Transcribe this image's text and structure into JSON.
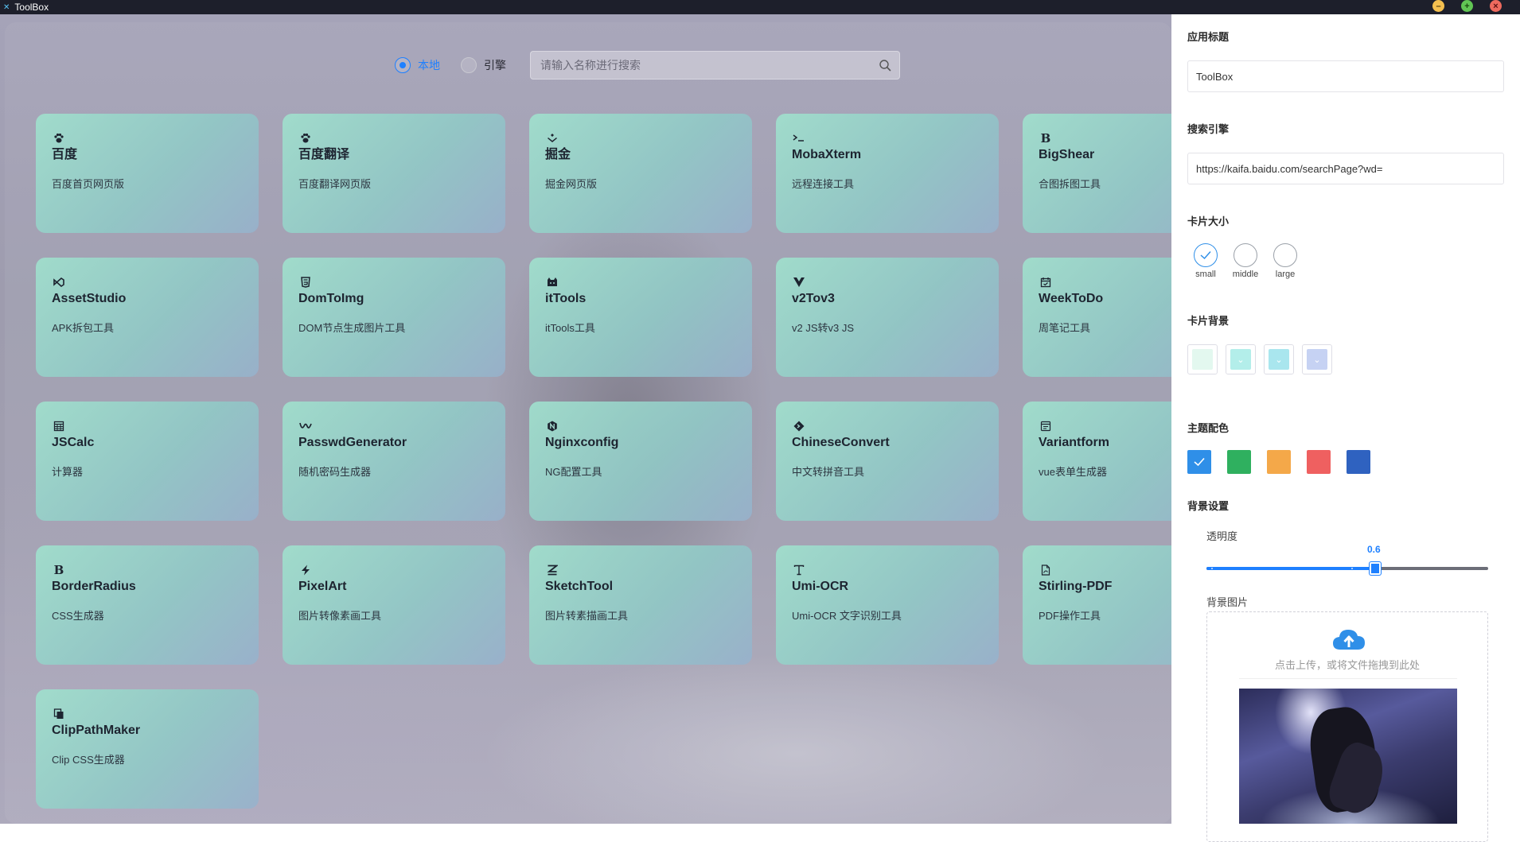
{
  "window": {
    "title": "ToolBox",
    "controls": [
      "–",
      "+",
      "×"
    ]
  },
  "search": {
    "mode_local": "本地",
    "mode_engine": "引擎",
    "selected_mode": "本地",
    "placeholder": "请输入名称进行搜索"
  },
  "cards": [
    {
      "icon": "paw-icon",
      "name": "百度",
      "desc": "百度首页网页版"
    },
    {
      "icon": "paw-icon",
      "name": "百度翻译",
      "desc": "百度翻译网页版"
    },
    {
      "icon": "juejin-icon",
      "name": "掘金",
      "desc": "掘金网页版"
    },
    {
      "icon": "terminal-icon",
      "name": "MobaXterm",
      "desc": "远程连接工具"
    },
    {
      "icon": "letter-b-icon",
      "name": "BigShear",
      "desc": "合图拆图工具"
    },
    {
      "icon": "vscode-icon",
      "name": "AssetStudio",
      "desc": "APK拆包工具"
    },
    {
      "icon": "html5-icon",
      "name": "DomToImg",
      "desc": "DOM节点生成图片工具"
    },
    {
      "icon": "cat-icon",
      "name": "itTools",
      "desc": "itTools工具"
    },
    {
      "icon": "vue-icon",
      "name": "v2Tov3",
      "desc": "v2 JS转v3 JS"
    },
    {
      "icon": "calendar-icon",
      "name": "WeekToDo",
      "desc": "周笔记工具"
    },
    {
      "icon": "calculator-icon",
      "name": "JSCalc",
      "desc": "计算器"
    },
    {
      "icon": "key-icon",
      "name": "PasswdGenerator",
      "desc": "随机密码生成器"
    },
    {
      "icon": "nginx-icon",
      "name": "Nginxconfig",
      "desc": "NG配置工具"
    },
    {
      "icon": "convert-icon",
      "name": "ChineseConvert",
      "desc": "中文转拼音工具"
    },
    {
      "icon": "form-icon",
      "name": "Variantform",
      "desc": "vue表单生成器"
    },
    {
      "icon": "letter-b-icon",
      "name": "BorderRadius",
      "desc": "CSS生成器"
    },
    {
      "icon": "pixel-icon",
      "name": "PixelArt",
      "desc": "图片转像素画工具"
    },
    {
      "icon": "sketch-icon",
      "name": "SketchTool",
      "desc": "图片转素描画工具"
    },
    {
      "icon": "text-icon",
      "name": "Umi-OCR",
      "desc": "Umi-OCR 文字识别工具"
    },
    {
      "icon": "pdf-icon",
      "name": "Stirling-PDF",
      "desc": "PDF操作工具"
    },
    {
      "icon": "clip-icon",
      "name": "ClipPathMaker",
      "desc": "Clip CSS生成器"
    }
  ],
  "panel": {
    "app_title_label": "应用标题",
    "app_title_value": "ToolBox",
    "search_engine_label": "搜索引擎",
    "search_engine_value": "https://kaifa.baidu.com/searchPage?wd=",
    "card_size_label": "卡片大小",
    "card_sizes": [
      "small",
      "middle",
      "large"
    ],
    "card_size_selected": "small",
    "card_bg_label": "卡片背景",
    "card_bg_colors": [
      "#e3f8ef",
      "#b3eeea",
      "#a9e6ee",
      "#c6d2f3"
    ],
    "theme_label": "主题配色",
    "theme_colors": [
      "#2f8fe8",
      "#2fb05f",
      "#f4a849",
      "#ef6060",
      "#2f62c0"
    ],
    "theme_selected": 0,
    "bg_settings_label": "背景设置",
    "opacity_label": "透明度",
    "opacity_value": "0.6",
    "opacity_fraction": 0.6,
    "bg_image_label": "背景图片",
    "upload_text": "点击上传，或将文件拖拽到此处"
  }
}
